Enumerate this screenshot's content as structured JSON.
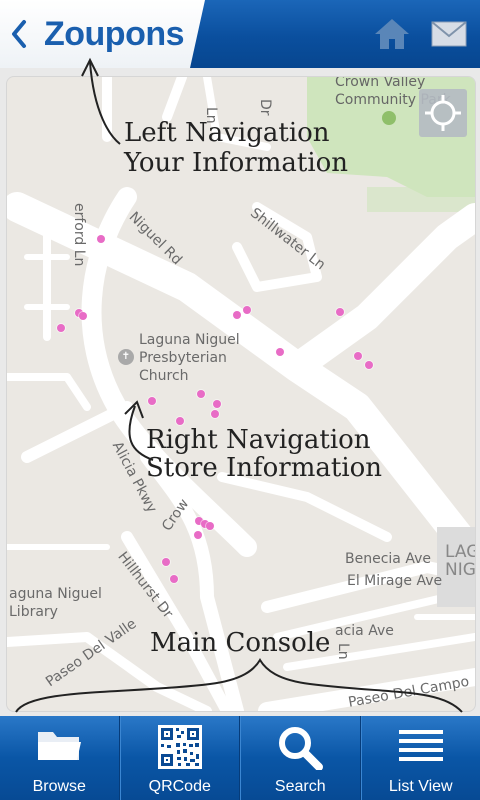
{
  "header": {
    "back_icon": "chevron-left-icon",
    "logo_text": "Zoupons",
    "home_icon": "home-icon",
    "mail_icon": "mail-icon"
  },
  "map": {
    "labels": {
      "community_park": "Crown Valley\nCommunity Park",
      "lindo_ln": "Ln",
      "dr_top": "Dr",
      "erford_ln": "erford Ln",
      "niguel_rd": "Niguel Rd",
      "shillwater_ln": "Shillwater Ln",
      "church": "Laguna Niguel\nPresbyterian\nChurch",
      "alicia_pkwy": "Alicia Pkwy",
      "crown": "Crow",
      "hillhurst_dr": "Hillhurst Dr",
      "benecia_ave": "Benecia Ave",
      "el_mirage_ave": "El Mirage Ave",
      "acacia_ave": "acia Ave",
      "ln_edge": "Ln",
      "library": "aguna Niguel\nLibrary",
      "paseo_del_valle": "Paseo Del Valle",
      "paseo_del_campo": "Paseo Del Campo",
      "lag_edge": "LAG\nNIG"
    },
    "locate_icon": "crosshair-locate-icon"
  },
  "annotations": {
    "left_nav": "Left Navigation\nYour Information",
    "right_nav": "Right Navigation\nStore Information",
    "main_console": "Main Console"
  },
  "tabs": [
    {
      "label": "Browse",
      "icon": "folder-icon"
    },
    {
      "label": "QRCode",
      "icon": "qr-code-icon"
    },
    {
      "label": "Search",
      "icon": "magnifier-icon"
    },
    {
      "label": "List View",
      "icon": "list-icon"
    }
  ],
  "colors": {
    "header_blue": "#0a4f9e",
    "tab_blue": "#0a56a6",
    "pin_pink": "#e86cc6",
    "park_green": "#cfe5bd"
  }
}
